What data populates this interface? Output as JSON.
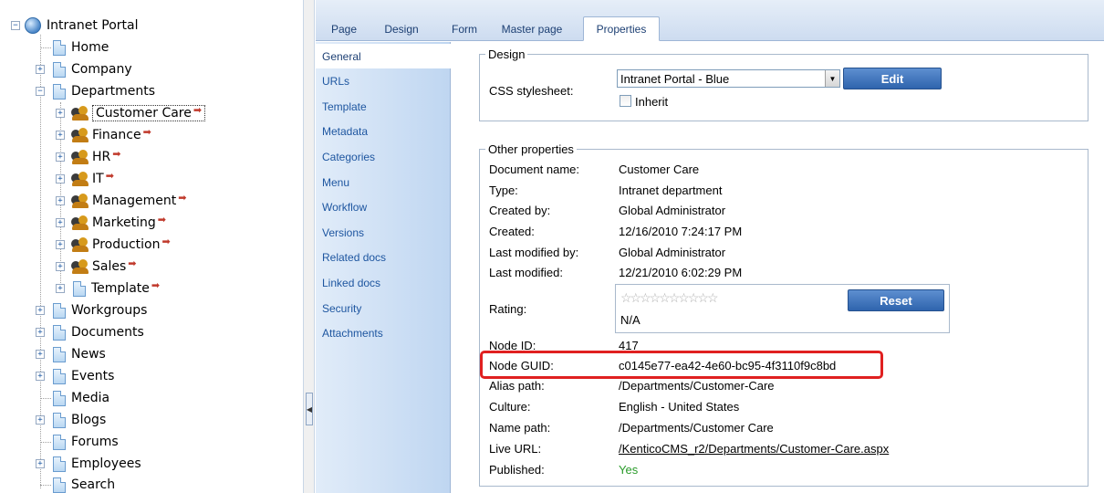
{
  "tree": {
    "root": "Intranet Portal",
    "items": [
      {
        "label": "Home"
      },
      {
        "label": "Company"
      },
      {
        "label": "Departments"
      },
      {
        "label": "Customer Care"
      },
      {
        "label": "Finance"
      },
      {
        "label": "HR"
      },
      {
        "label": "IT"
      },
      {
        "label": "Management"
      },
      {
        "label": "Marketing"
      },
      {
        "label": "Production"
      },
      {
        "label": "Sales"
      },
      {
        "label": "Template"
      },
      {
        "label": "Workgroups"
      },
      {
        "label": "Documents"
      },
      {
        "label": "News"
      },
      {
        "label": "Events"
      },
      {
        "label": "Media"
      },
      {
        "label": "Blogs"
      },
      {
        "label": "Forums"
      },
      {
        "label": "Employees"
      },
      {
        "label": "Search"
      }
    ],
    "expand_symbol": "+",
    "collapse_symbol": "−",
    "link_arrow": "➡"
  },
  "tabs": [
    {
      "label": "Page"
    },
    {
      "label": "Design"
    },
    {
      "label": "Form"
    },
    {
      "label": "Master page"
    },
    {
      "label": "Properties"
    }
  ],
  "property_menu": [
    {
      "label": "General"
    },
    {
      "label": "URLs"
    },
    {
      "label": "Template"
    },
    {
      "label": "Metadata"
    },
    {
      "label": "Categories"
    },
    {
      "label": "Menu"
    },
    {
      "label": "Workflow"
    },
    {
      "label": "Versions"
    },
    {
      "label": "Related docs"
    },
    {
      "label": "Linked docs"
    },
    {
      "label": "Security"
    },
    {
      "label": "Attachments"
    }
  ],
  "design": {
    "legend": "Design",
    "css_label": "CSS stylesheet:",
    "css_value": "Intranet Portal - Blue",
    "edit_button": "Edit",
    "inherit_label": "Inherit"
  },
  "other": {
    "legend": "Other properties",
    "labels": {
      "document_name": "Document name:",
      "type": "Type:",
      "created_by": "Created by:",
      "created": "Created:",
      "last_modified_by": "Last modified by:",
      "last_modified": "Last modified:",
      "rating": "Rating:",
      "node_id": "Node ID:",
      "node_guid": "Node GUID:",
      "alias_path": "Alias path:",
      "culture": "Culture:",
      "name_path": "Name path:",
      "live_url": "Live URL:",
      "published": "Published:"
    },
    "values": {
      "document_name": "Customer Care",
      "type": "Intranet department",
      "created_by": "Global Administrator",
      "created": "12/16/2010 7:24:17 PM",
      "last_modified_by": "Global Administrator",
      "last_modified": "12/21/2010 6:02:29 PM",
      "rating_value": "N/A",
      "rating_stars": "☆☆☆☆☆☆☆☆☆☆",
      "reset_button": "Reset",
      "node_id": "417",
      "node_guid": "c0145e77-ea42-4e60-bc95-4f3110f9c8bd",
      "alias_path": "/Departments/Customer-Care",
      "culture": "English - United States",
      "name_path": "/Departments/Customer Care",
      "live_url": "/KenticoCMS_r2/Departments/Customer-Care.aspx",
      "published": "Yes"
    }
  },
  "colors": {
    "accent": "#1e56a0",
    "highlight": "#e02020",
    "published": "#2a9b2a"
  },
  "splitter_icon": "◀"
}
